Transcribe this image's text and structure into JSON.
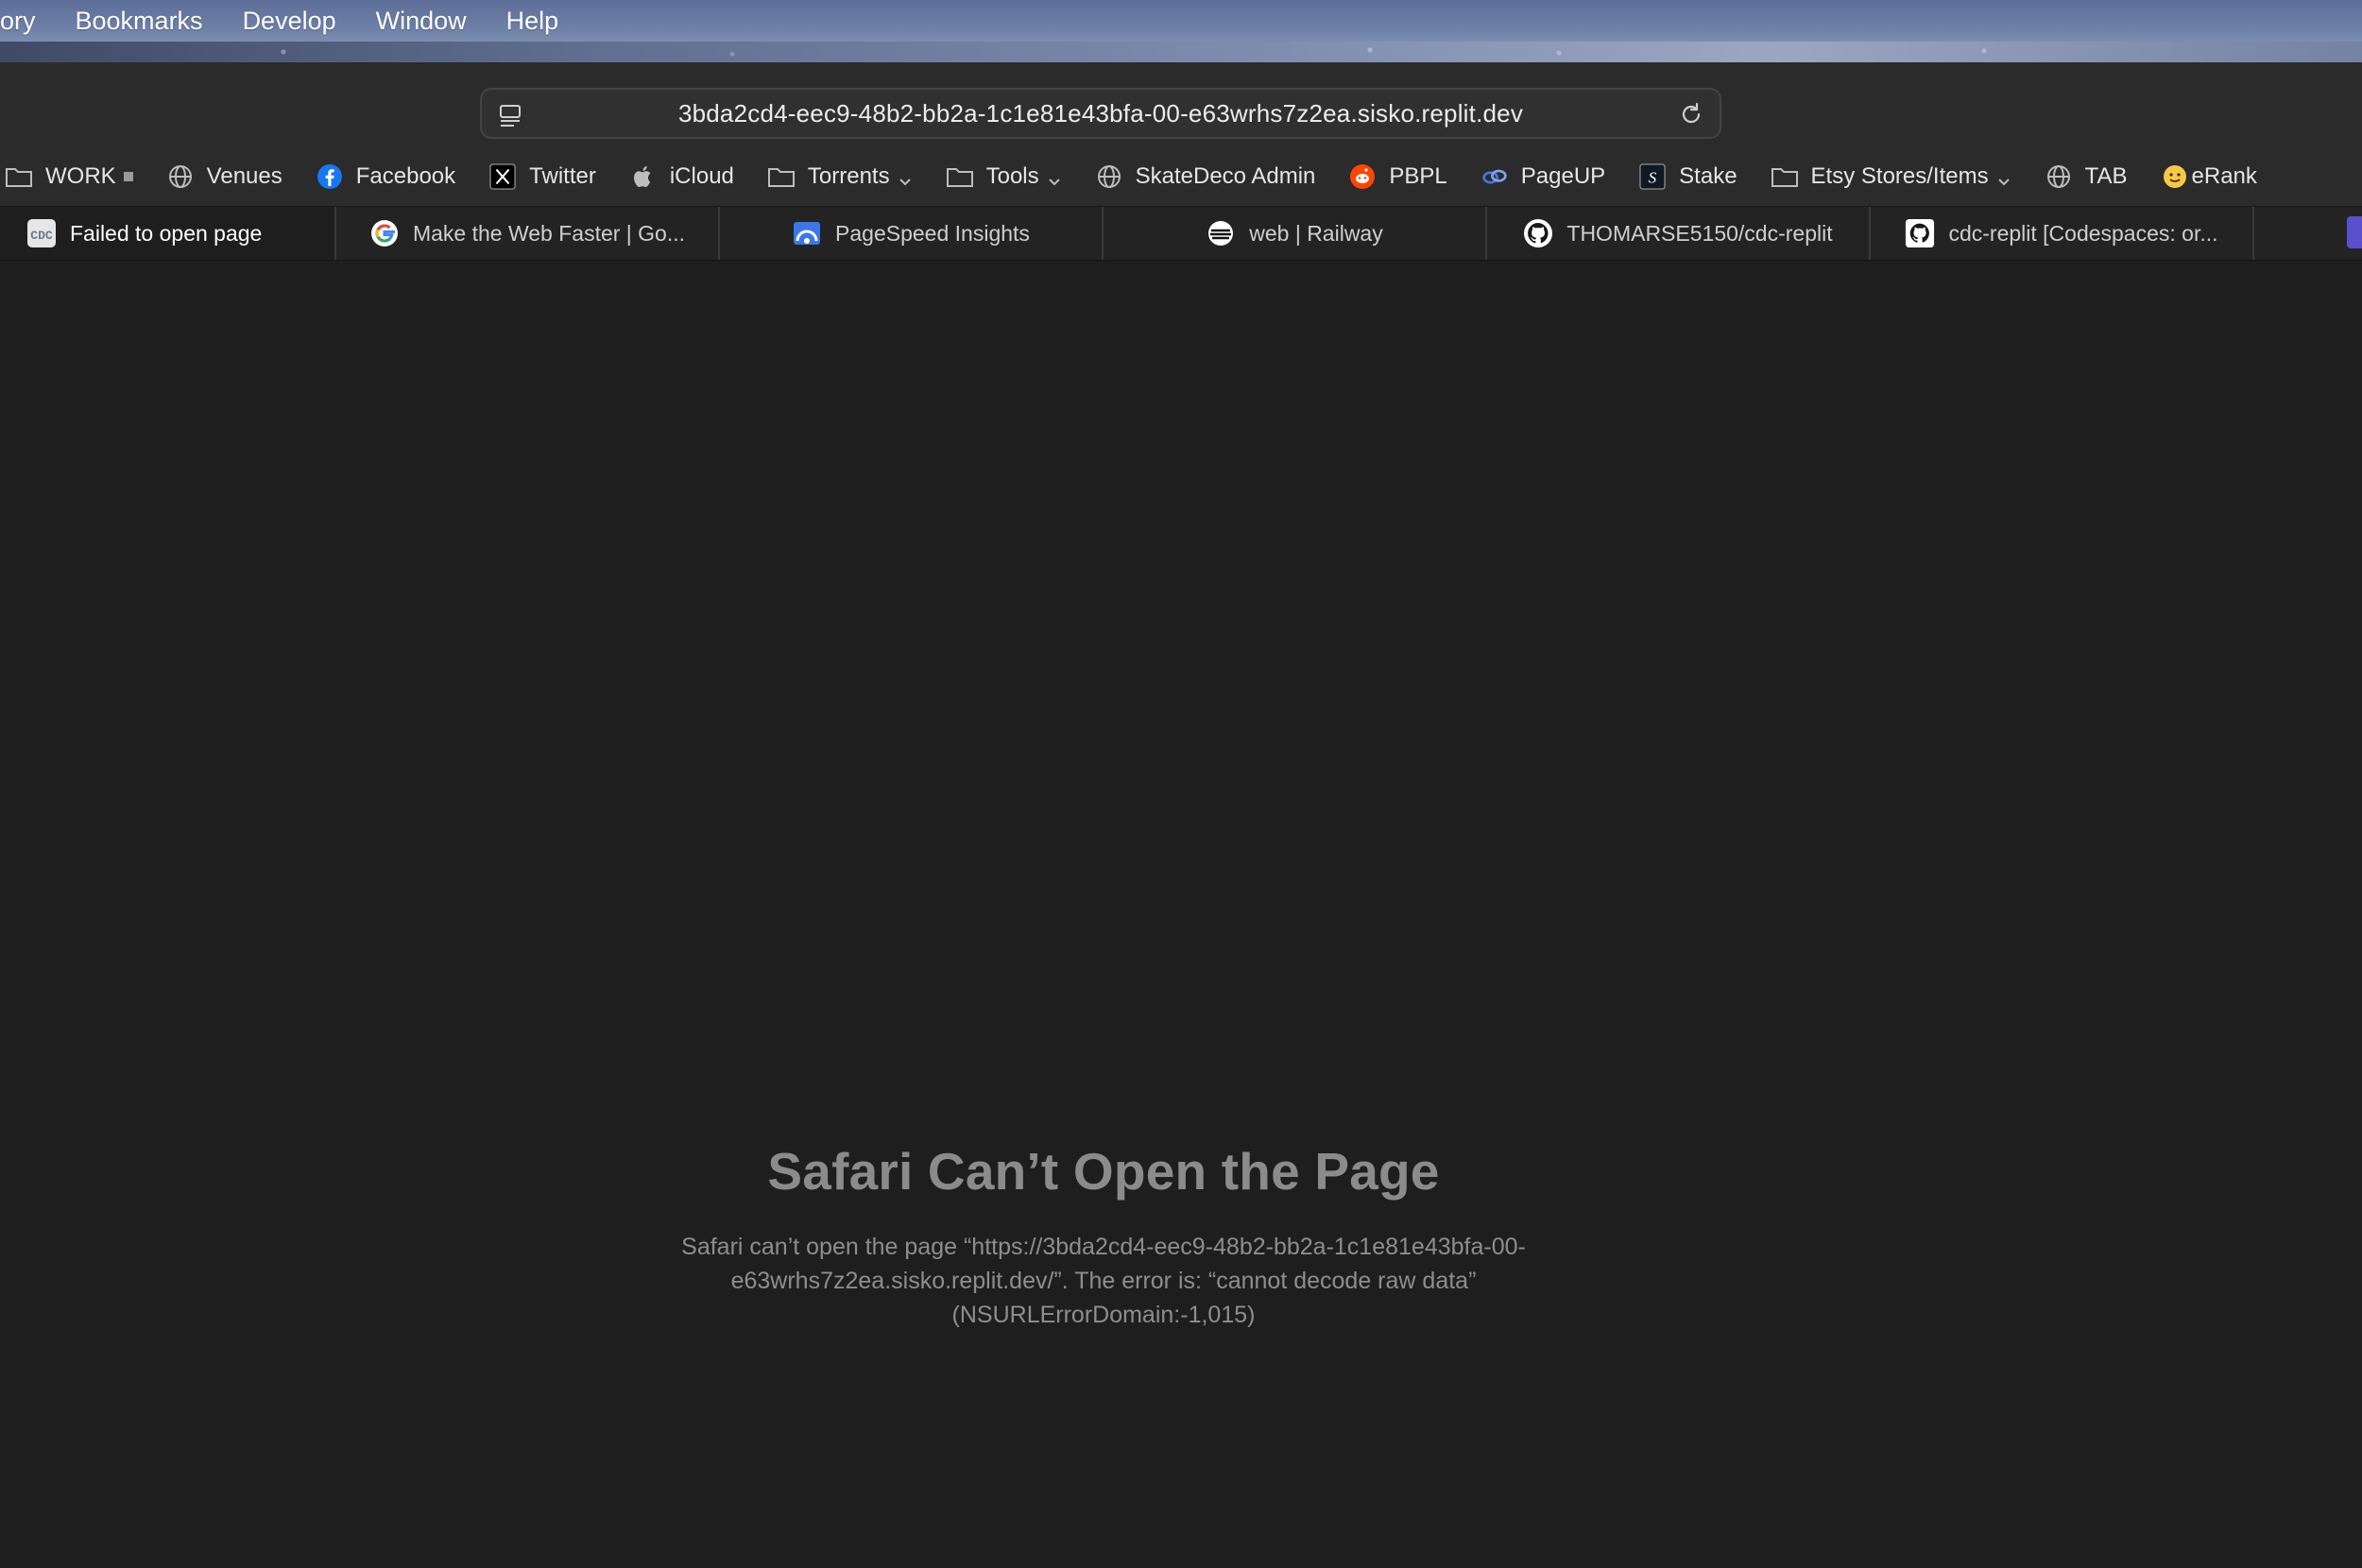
{
  "menubar": {
    "items": [
      "ory",
      "Bookmarks",
      "Develop",
      "Window",
      "Help"
    ]
  },
  "address_bar": {
    "url": "3bda2cd4-eec9-48b2-bb2a-1c1e81e43bfa-00-e63wrhs7z2ea.sisko.replit.dev"
  },
  "bookmarks": [
    {
      "label": "WORK",
      "icon": "folder-icon"
    },
    {
      "label": "Venues",
      "icon": "globe-icon"
    },
    {
      "label": "Facebook",
      "icon": "facebook-icon"
    },
    {
      "label": "Twitter",
      "icon": "x-icon"
    },
    {
      "label": "iCloud",
      "icon": "apple-icon"
    },
    {
      "label": "Torrents",
      "icon": "folder-icon"
    },
    {
      "label": "Tools",
      "icon": "folder-icon"
    },
    {
      "label": "SkateDeco Admin",
      "icon": "globe-icon"
    },
    {
      "label": "PBPL",
      "icon": "reddit-icon"
    },
    {
      "label": "PageUP",
      "icon": "link-icon"
    },
    {
      "label": "Stake",
      "icon": "stake-icon"
    },
    {
      "label": "Etsy Stores/Items",
      "icon": "folder-icon"
    },
    {
      "label": "TAB",
      "icon": "globe-icon"
    },
    {
      "label": "eRank",
      "icon": "smiley-icon"
    }
  ],
  "tabs": [
    {
      "label": "Failed to open page",
      "icon": "cdc-icon",
      "active": true
    },
    {
      "label": "Make the Web Faster  |  Go...",
      "icon": "google-icon",
      "active": false
    },
    {
      "label": "PageSpeed Insights",
      "icon": "pagespeed-icon",
      "active": false
    },
    {
      "label": "web | Railway",
      "icon": "railway-icon",
      "active": false
    },
    {
      "label": "THOMARSE5150/cdc-replit",
      "icon": "github-icon",
      "active": false
    },
    {
      "label": "cdc-replit [Codespaces: or...",
      "icon": "github-icon",
      "active": false
    }
  ],
  "error": {
    "title": "Safari Can’t Open the Page",
    "line1": "Safari can’t open the page “https://3bda2cd4-eec9-48b2-bb2a-1c1e81e43bfa-00-",
    "line2": "e63wrhs7z2ea.sisko.replit.dev/”. The error is: “cannot decode raw data”",
    "line3": "(NSURLErrorDomain:-1,015)"
  },
  "colors": {
    "page_bg": "#1e1e1e",
    "toolbar_bg": "#2b2b2b",
    "error_text": "#8b8b8b"
  }
}
